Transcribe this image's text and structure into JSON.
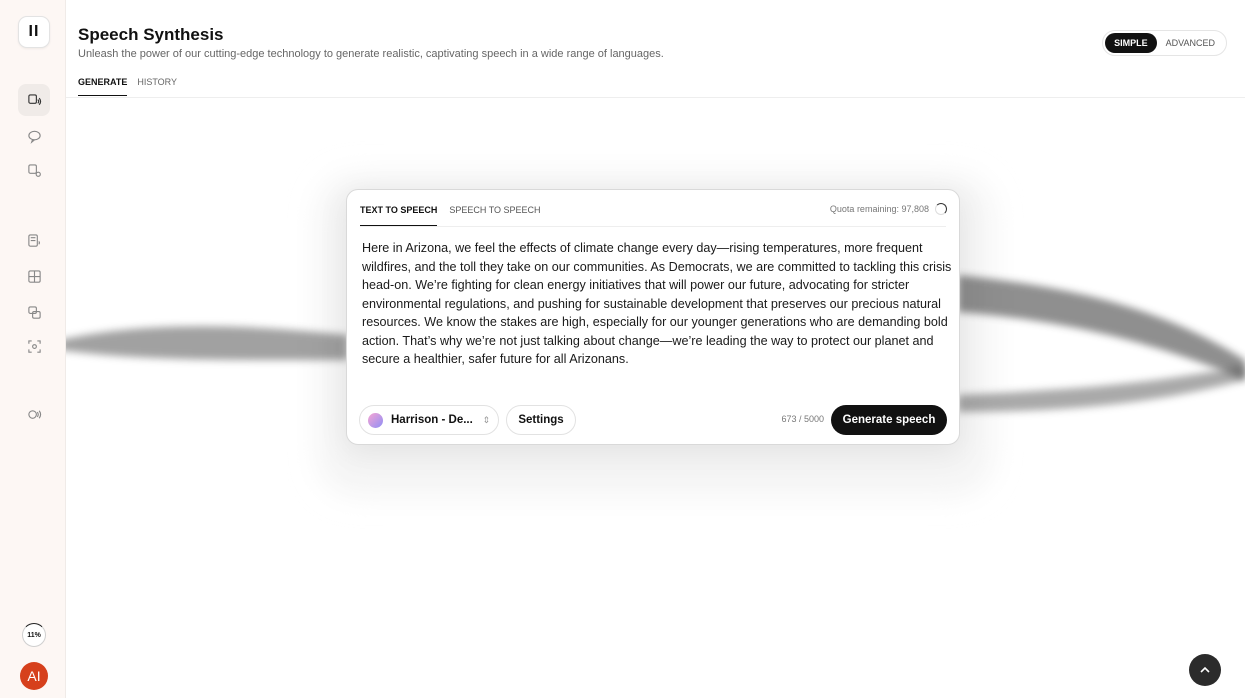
{
  "sidebar": {
    "logo": "II",
    "nav": [
      {
        "icon": "speech-synthesis-icon",
        "active": true
      },
      {
        "icon": "chat-bubble-icon",
        "active": false
      },
      {
        "icon": "voice-settings-icon",
        "active": false
      },
      {
        "icon": "document-audio-icon",
        "active": false
      },
      {
        "icon": "grid-layout-icon",
        "active": false
      },
      {
        "icon": "dubbing-icon",
        "active": false
      },
      {
        "icon": "voice-isolator-icon",
        "active": false
      },
      {
        "icon": "audio-wave-icon",
        "active": false
      }
    ],
    "usage_label": "11%",
    "usage_fraction": 0.11,
    "avatar_initials": "AI",
    "avatar_color": "#d6401c"
  },
  "header": {
    "title": "Speech Synthesis",
    "subtitle": "Unleash the power of our cutting-edge technology to generate realistic, captivating speech in a wide range of languages.",
    "tabs": [
      {
        "label": "GENERATE",
        "active": true
      },
      {
        "label": "HISTORY",
        "active": false
      }
    ],
    "mode": {
      "simple": "SIMPLE",
      "advanced": "ADVANCED",
      "selected": "SIMPLE"
    }
  },
  "card": {
    "tabs": [
      {
        "label": "TEXT TO SPEECH",
        "active": true
      },
      {
        "label": "SPEECH TO SPEECH",
        "active": false
      }
    ],
    "quota": "Quota remaining: 97,808",
    "text": "Here in Arizona, we feel the effects of climate change every day—rising temperatures, more frequent wildfires, and the toll they take on our communities. As Democrats, we are committed to tackling this crisis head-on. We’re fighting for clean energy initiatives that will power our future, advocating for stricter environmental regulations, and pushing for sustainable development that preserves our precious natural resources. We know the stakes are high, especially for our younger generations who are demanding bold action. That’s why we’re not just talking about change—we’re leading the way to protect our planet and secure a healthier, safer future for all Arizonans.",
    "voice": "Harrison - De...",
    "settings_label": "Settings",
    "char_count": "673 / 5000",
    "generate_label": "Generate speech"
  },
  "colors": {
    "accent": "#111111",
    "sidebar_bg": "#fdf7f4"
  }
}
